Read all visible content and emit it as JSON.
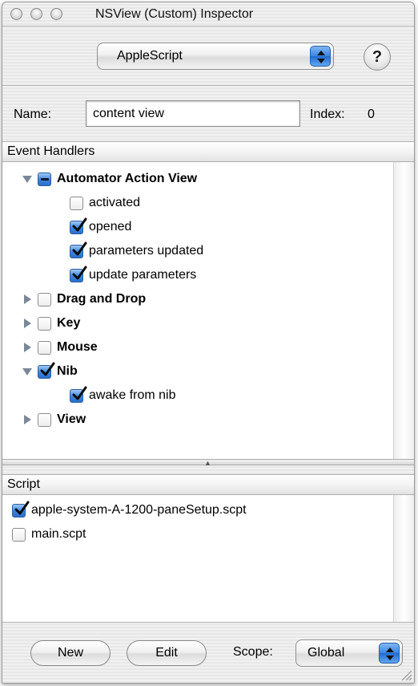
{
  "window": {
    "title": "NSView (Custom) Inspector"
  },
  "toolbar": {
    "pane_popup": "AppleScript",
    "help": "?"
  },
  "name_row": {
    "name_label": "Name:",
    "name_value": "content view",
    "index_label": "Index:",
    "index_value": "0"
  },
  "handlers": {
    "header": "Event Handlers",
    "groups": [
      {
        "label": "Automator Action View",
        "expanded": true,
        "state": "mixed",
        "items": [
          {
            "label": "activated",
            "checked": false
          },
          {
            "label": "opened",
            "checked": true
          },
          {
            "label": "parameters updated",
            "checked": true
          },
          {
            "label": "update parameters",
            "checked": true
          }
        ]
      },
      {
        "label": "Drag and Drop",
        "expanded": false,
        "state": "off"
      },
      {
        "label": "Key",
        "expanded": false,
        "state": "off"
      },
      {
        "label": "Mouse",
        "expanded": false,
        "state": "off"
      },
      {
        "label": "Nib",
        "expanded": true,
        "state": "on",
        "items": [
          {
            "label": "awake from nib",
            "checked": true
          }
        ]
      },
      {
        "label": "View",
        "expanded": false,
        "state": "off"
      }
    ]
  },
  "scripts": {
    "header": "Script",
    "items": [
      {
        "label": "apple-system-A-1200-paneSetup.scpt",
        "checked": true
      },
      {
        "label": "main.scpt",
        "checked": false
      }
    ]
  },
  "footer": {
    "new_label": "New",
    "edit_label": "Edit",
    "scope_label": "Scope:",
    "scope_value": "Global"
  },
  "colors": {
    "accent": "#3a86e0",
    "window_bg": "#ececec"
  }
}
